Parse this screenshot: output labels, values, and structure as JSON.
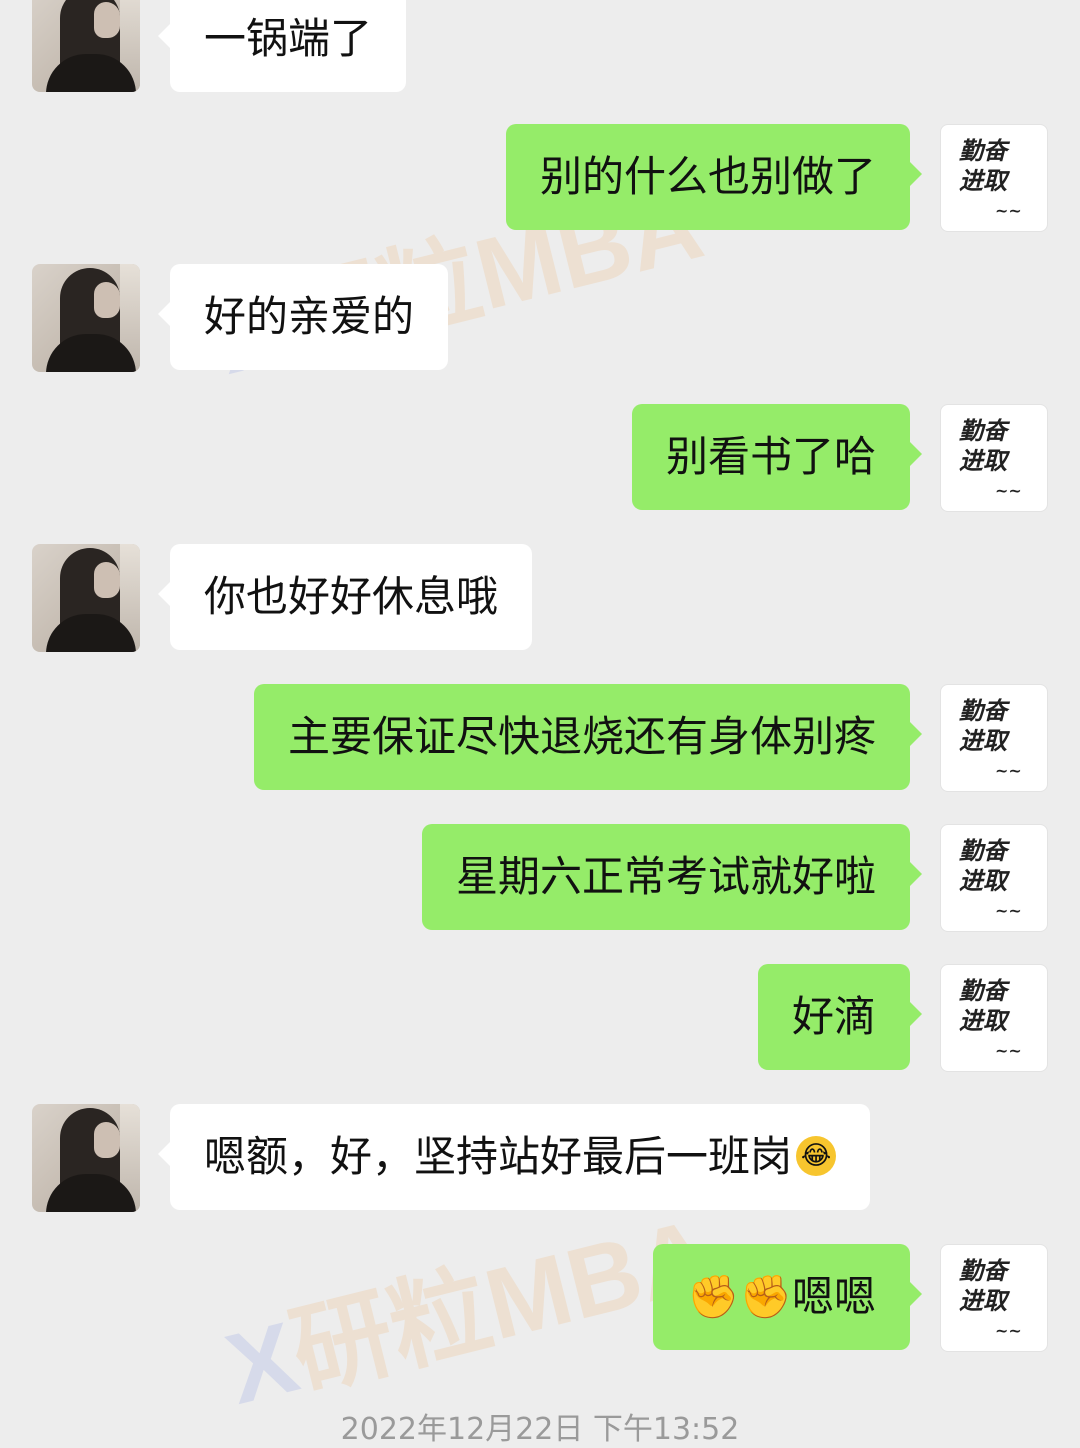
{
  "messages": [
    {
      "side": "in",
      "text": "一锅端了"
    },
    {
      "side": "out",
      "text": "别的什么也别做了"
    },
    {
      "side": "in",
      "text": "好的亲爱的"
    },
    {
      "side": "out",
      "text": "别看书了哈"
    },
    {
      "side": "in",
      "text": "你也好好休息哦"
    },
    {
      "side": "out",
      "text": "主要保证尽快退烧还有身体别疼"
    },
    {
      "side": "out",
      "text": "星期六正常考试就好啦"
    },
    {
      "side": "out",
      "text": "好滴"
    },
    {
      "side": "in",
      "text": "嗯额，好，坚持站好最后一班岗",
      "emoji": "😂"
    },
    {
      "side": "out",
      "text": "嗯嗯",
      "prefix_emoji": "✊✊"
    }
  ],
  "avatar_right_text": {
    "line1": "勤奋",
    "line2": "进取"
  },
  "watermark": {
    "mark": "X",
    "text": "研粒MBA"
  },
  "timestamp": "2022年12月22日 下午13:52"
}
